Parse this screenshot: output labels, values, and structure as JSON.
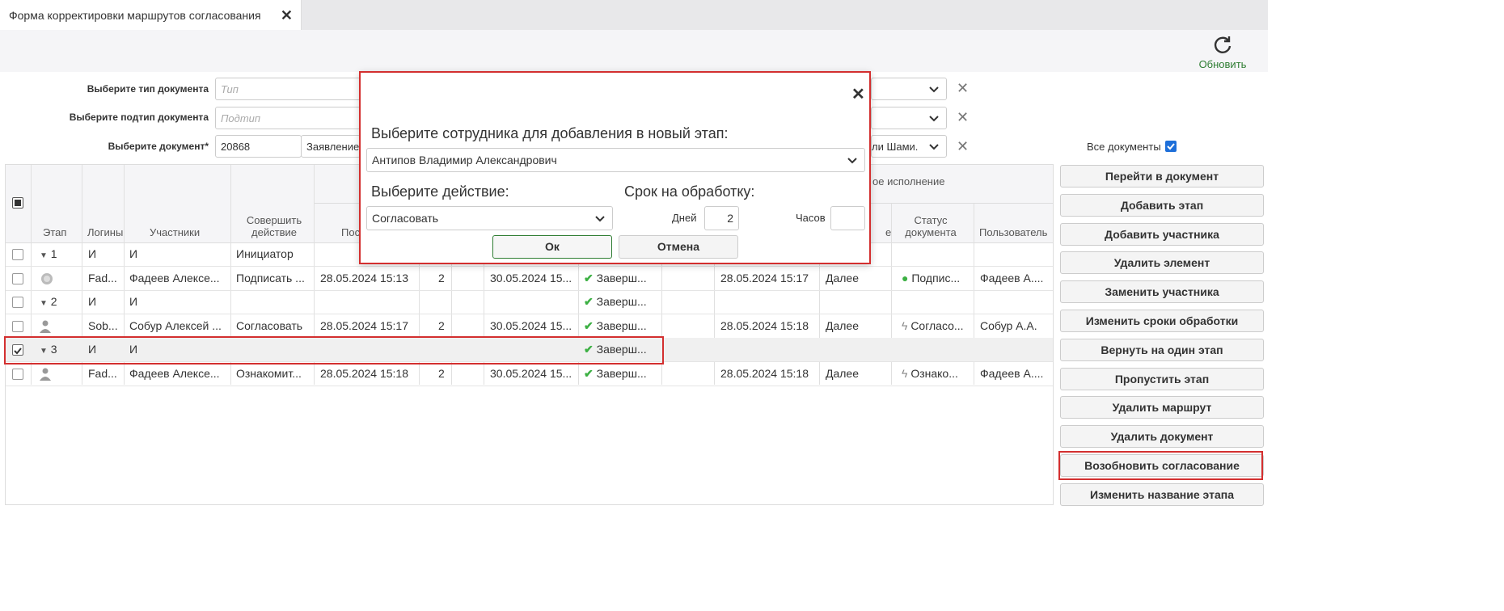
{
  "tab": {
    "title": "Форма корректировки маршрутов согласования"
  },
  "toolbar": {
    "refresh_label": "Обновить"
  },
  "filters": {
    "doc_type_label": "Выберите тип документа",
    "doc_type_placeholder": "Тип",
    "doc_subtype_label": "Выберите подтип документа",
    "doc_subtype_placeholder": "Подтип",
    "document_label": "Выберите документ*",
    "document_number": "20868",
    "document_name_visible": "Заявление",
    "document_person_visible": "ли Шами.",
    "all_docs_label": "Все документы",
    "all_docs_checked": true
  },
  "table": {
    "headers": {
      "stage": "Этап",
      "login": "Логины",
      "participants": "Участники",
      "action": "Совершить действие",
      "received": "Пос",
      "group_right": "ое исполнение",
      "col_e": "е",
      "doc_status": "Статус документа",
      "user": "Пользователь"
    },
    "rows": [
      {
        "stage": "1",
        "login": "И",
        "participant": "И",
        "action": "Инициатор",
        "received": "",
        "n": "",
        "due": "",
        "status": "",
        "done": "",
        "next": "",
        "doc_status": "",
        "user": "",
        "type": "stage"
      },
      {
        "stage": "",
        "login": "Fad...",
        "participant": "Фадеев Алексе...",
        "action": "Подписать ...",
        "received": "28.05.2024 15:13",
        "n": "2",
        "due": "30.05.2024 15...",
        "status": "Заверш...",
        "done": "28.05.2024 15:17",
        "next": "Далее",
        "doc_status": "Подпис...",
        "user": "Фадеев А....",
        "type": "user"
      },
      {
        "stage": "2",
        "login": "И",
        "participant": "И",
        "action": "",
        "received": "",
        "n": "",
        "due": "",
        "status": "Заверш...",
        "done": "",
        "next": "",
        "doc_status": "",
        "user": "",
        "type": "stage"
      },
      {
        "stage": "",
        "login": "Sob...",
        "participant": "Собур Алексей ...",
        "action": "Согласовать",
        "received": "28.05.2024 15:17",
        "n": "2",
        "due": "30.05.2024 15...",
        "status": "Заверш...",
        "done": "28.05.2024 15:18",
        "next": "Далее",
        "doc_status": "Согласо...",
        "user": "Собур А.А.",
        "type": "user"
      },
      {
        "stage": "3",
        "login": "И",
        "participant": "И",
        "action": "",
        "received": "",
        "n": "",
        "due": "",
        "status": "Заверш...",
        "done": "",
        "next": "",
        "doc_status": "",
        "user": "",
        "type": "stage",
        "selected": true
      },
      {
        "stage": "",
        "login": "Fad...",
        "participant": "Фадеев Алексе...",
        "action": "Ознакомит...",
        "received": "28.05.2024 15:18",
        "n": "2",
        "due": "30.05.2024 15...",
        "status": "Заверш...",
        "done": "28.05.2024 15:18",
        "next": "Далее",
        "doc_status": "Ознако...",
        "user": "Фадеев А....",
        "type": "user"
      }
    ]
  },
  "actions": [
    "Перейти в документ",
    "Добавить этап",
    "Добавить участника",
    "Удалить элемент",
    "Заменить участника",
    "Изменить сроки обработки",
    "Вернуть на один этап",
    "Пропустить этап",
    "Удалить маршрут",
    "Удалить документ",
    "Возобновить согласование",
    "Изменить название этапа"
  ],
  "modal": {
    "employee_label": "Выберите сотрудника для добавления в новый этап:",
    "employee_value": "Антипов Владимир Александрович",
    "action_label": "Выберите действие:",
    "action_value": "Согласовать",
    "deadline_label": "Срок на обработку:",
    "days_label": "Дней",
    "days_value": "2",
    "hours_label": "Часов",
    "hours_value": "",
    "ok_label": "Ок",
    "cancel_label": "Отмена"
  },
  "colors": {
    "accent_green": "#2e7d32",
    "highlight_red": "#d32f2f",
    "check_green": "#3cb043"
  }
}
